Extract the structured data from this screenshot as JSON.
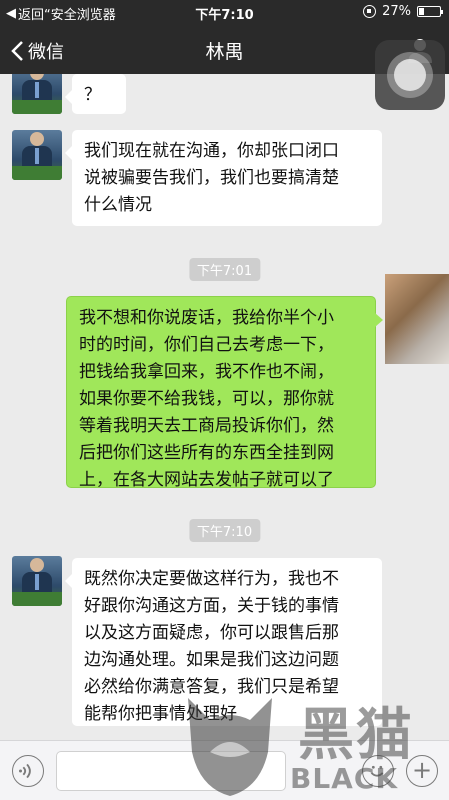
{
  "status_bar": {
    "back_app": "返回“安全浏览器",
    "time": "下午7:10",
    "battery_percent": "27%",
    "battery_level": 0.27
  },
  "nav": {
    "back_label": "微信",
    "title": "林禺",
    "back_icon": "chevron-left-icon",
    "profile_icon": "person-icon"
  },
  "messages": [
    {
      "side": "left",
      "text": "？"
    },
    {
      "side": "left",
      "text": "我们现在就在沟通，你却张口闭口\n说被骗要告我们，我们也要搞清楚\n什么情况"
    },
    {
      "type": "time",
      "text": "下午7:01"
    },
    {
      "side": "right",
      "text": "我不想和你说废话，我给你半个小\n时的时间，你们自己去考虑一下，\n把钱给我拿回来，我不作也不闹，\n如果你要不给我钱，可以，那你就\n等着我明天去工商局投诉你们，然\n后把你们这些所有的东西全挂到网\n上，在各大网站去发帖子就可以了"
    },
    {
      "type": "time",
      "text": "下午7:10"
    },
    {
      "side": "left",
      "text": "既然你决定要做这样行为，我也不\n好跟你沟通这方面，关于钱的事情\n以及这方面疑虑，你可以跟售后那\n边沟通处理。如果是我们这边问题\n必然给你满意答复，我们只是希望\n能帮你把事情处理好"
    }
  ],
  "input_bar": {
    "voice_icon": "voice-icon",
    "emoji_icon": "emoji-icon",
    "plus_label": "+"
  },
  "watermark": {
    "cn": "黑猫",
    "en": "BLACK CAT"
  },
  "colors": {
    "bar_bg": "#2a2a2a",
    "chat_bg": "#ebebeb",
    "sent_bubble": "#a0e75a",
    "received_bubble": "#ffffff",
    "time_badge": "#cecece"
  }
}
